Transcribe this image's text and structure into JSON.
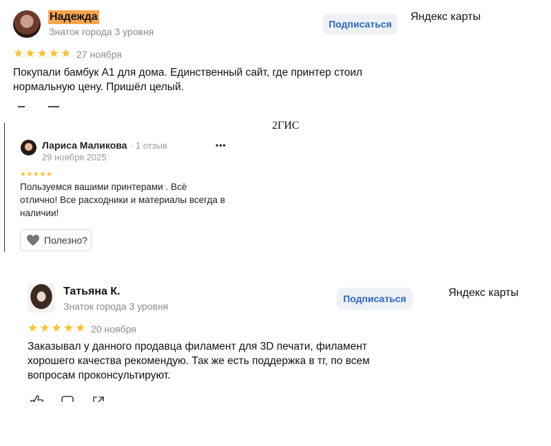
{
  "review1": {
    "name": "Надежда",
    "level": "Знаток города 3 уровня",
    "subscribe_label": "Подписаться",
    "source": "Яндекс карты",
    "stars": "★★★★★",
    "date": "27 ноября",
    "text_line1": "Покупали бамбук А1 для дома. Единственный сайт, где принтер стоил",
    "text_line2": "нормальную цену. Пришёл целый."
  },
  "review2": {
    "source": "2ГИС",
    "name": "Лариса Маликова",
    "review_count": "· 1 отзыв",
    "date": "29 ноября 2025",
    "stars": "★★★★★",
    "text_line1": "Пользуемся вашими принтерами . Всё",
    "text_line2": "отлично! Все расходники и материалы всегда в",
    "text_line3": "наличии!",
    "useful_label": "Полезно?",
    "more_icon": "•••"
  },
  "review3": {
    "name": "Татьяна К.",
    "level": "Знаток города 3 уровня",
    "subscribe_label": "Подписаться",
    "source": "Яндекс карты",
    "stars": "★★★★★",
    "date": "20 ноября",
    "text_line1": "Заказывал у данного продавца филамент для 3D печати, филамент",
    "text_line2": "хорошего качества рекомендую. Так же есть поддержка в тг, по всем",
    "text_line3": "вопросам проконсультируют."
  },
  "colors": {
    "star": "#fcc02e",
    "highlight": "#f7a64b",
    "link_blue": "#2a66c9"
  }
}
